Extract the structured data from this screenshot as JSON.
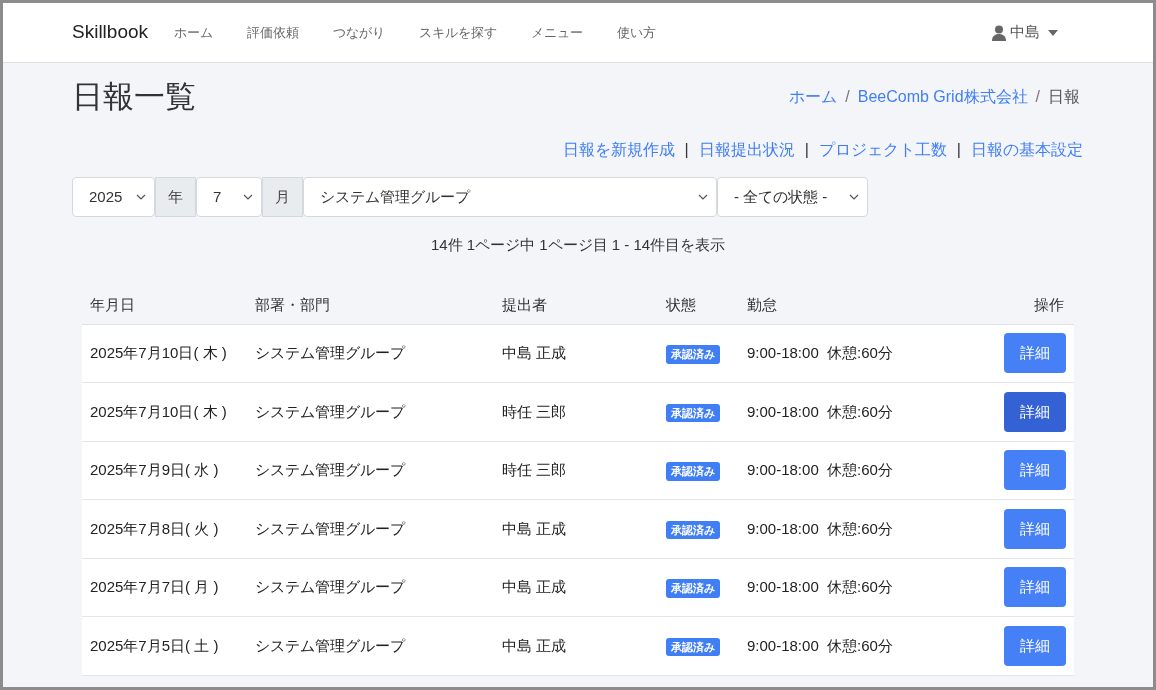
{
  "navbar": {
    "brand": "Skillbook",
    "items": [
      {
        "label": "ホーム"
      },
      {
        "label": "評価依頼"
      },
      {
        "label": "つながり"
      },
      {
        "label": "スキルを探す"
      },
      {
        "label": "メニュー"
      },
      {
        "label": "使い方"
      }
    ],
    "user": "中島"
  },
  "page_title": "日報一覧",
  "breadcrumb_separator": "/",
  "action_separator": "|",
  "breadcrumb": [
    {
      "label": "ホーム",
      "link": true
    },
    {
      "label": "BeeComb Grid株式会社",
      "link": true
    },
    {
      "label": "日報",
      "link": false
    }
  ],
  "actions": [
    {
      "label": "日報を新規作成"
    },
    {
      "label": "日報提出状況"
    },
    {
      "label": "プロジェクト工数"
    },
    {
      "label": "日報の基本設定"
    }
  ],
  "filters": {
    "year": "2025",
    "year_unit": "年",
    "month": "7",
    "month_unit": "月",
    "group": "システム管理グループ",
    "status": "- 全ての状態 -"
  },
  "summary": "14件 1ページ中 1ページ目 1 - 14件目を表示",
  "table": {
    "columns": [
      "年月日",
      "部署・部門",
      "提出者",
      "状態",
      "勤怠",
      "操作"
    ],
    "rows": [
      {
        "date": "2025年7月10日( 木 )",
        "dept": "システム管理グループ",
        "submitter": "中島 正成",
        "status": "承認済み",
        "color": "#3f7ef5",
        "attendance": "9:00-18:00  休憩:60分",
        "button": "詳細",
        "hovered": false
      },
      {
        "date": "2025年7月10日( 木 )",
        "dept": "システム管理グループ",
        "submitter": "時任 三郎",
        "status": "承認済み",
        "color": "#3f7ef5",
        "attendance": "9:00-18:00  休憩:60分",
        "button": "詳細",
        "hovered": true
      },
      {
        "date": "2025年7月9日( 水 )",
        "dept": "システム管理グループ",
        "submitter": "時任 三郎",
        "status": "承認済み",
        "color": "#3f7ef5",
        "attendance": "9:00-18:00  休憩:60分",
        "button": "詳細",
        "hovered": false
      },
      {
        "date": "2025年7月8日( 火 )",
        "dept": "システム管理グループ",
        "submitter": "中島 正成",
        "status": "承認済み",
        "color": "#3f7ef5",
        "attendance": "9:00-18:00  休憩:60分",
        "button": "詳細",
        "hovered": false
      },
      {
        "date": "2025年7月7日( 月 )",
        "dept": "システム管理グループ",
        "submitter": "中島 正成",
        "status": "承認済み",
        "color": "#3f7ef5",
        "attendance": "9:00-18:00  休憩:60分",
        "button": "詳細",
        "hovered": false
      },
      {
        "date": "2025年7月5日( 土 )",
        "dept": "システム管理グループ",
        "submitter": "中島 正成",
        "status": "承認済み",
        "color": "#3f7ef5",
        "attendance": "9:00-18:00  休憩:60分",
        "button": "詳細",
        "hovered": false
      }
    ]
  }
}
